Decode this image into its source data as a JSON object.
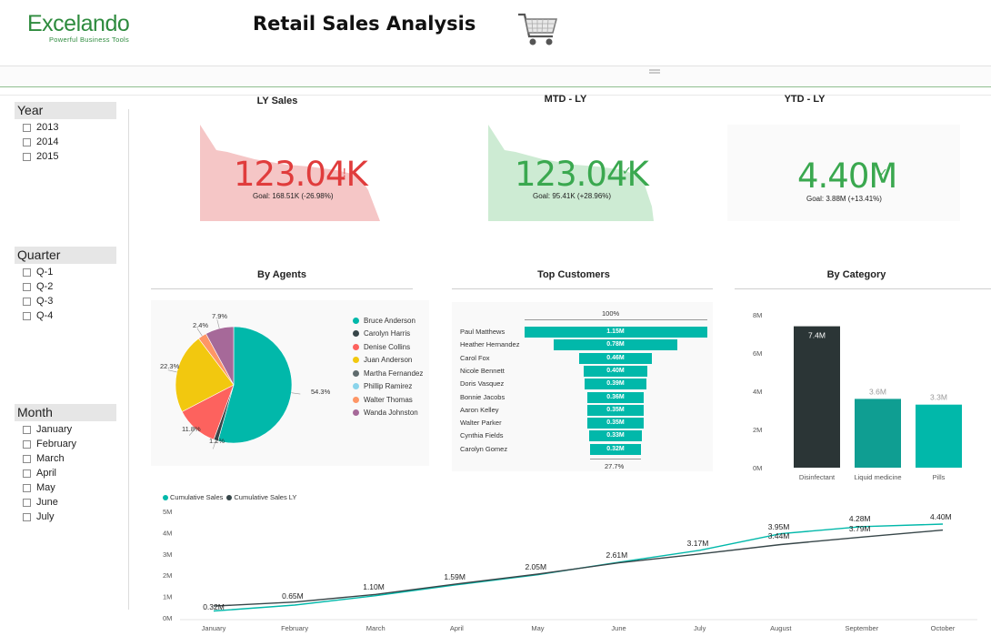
{
  "header": {
    "logo_text": "Excelando",
    "logo_tagline": "Powerful Business Tools",
    "title": "Retail Sales Analysis"
  },
  "slicers": {
    "year": {
      "title": "Year",
      "items": [
        "2013",
        "2014",
        "2015"
      ]
    },
    "quarter": {
      "title": "Quarter",
      "items": [
        "Q-1",
        "Q-2",
        "Q-3",
        "Q-4"
      ]
    },
    "month": {
      "title": "Month",
      "items": [
        "January",
        "February",
        "March",
        "April",
        "May",
        "June",
        "July"
      ]
    }
  },
  "kpis": [
    {
      "title": "LY Sales",
      "value": "123.04K",
      "goal": "Goal: 168.51K (-26.98%)",
      "status": "!",
      "color": "#e03c3c",
      "area_color": "#f5c6c6"
    },
    {
      "title": "MTD - LY",
      "value": "123.04K",
      "goal": "Goal: 95.41K (+28.96%)",
      "status": "✓",
      "color": "#3aa84f",
      "area_color": "#cdebd3"
    },
    {
      "title": "YTD - LY",
      "value": "4.40M",
      "goal": "Goal: 3.88M (+13.41%)",
      "status": "✓",
      "color": "#3aa84f",
      "area_color": "#ffffff"
    }
  ],
  "agents": {
    "title": "By Agents",
    "chart_data": {
      "type": "pie",
      "slices": [
        {
          "name": "Bruce Anderson",
          "value": 54.3,
          "color": "#01b8aa",
          "label": "54.3%"
        },
        {
          "name": "Carolyn Harris",
          "value": 1.2,
          "color": "#374649",
          "label": "1.2%"
        },
        {
          "name": "Denise Collins",
          "value": 11.8,
          "color": "#fd625e",
          "label": "11.8%"
        },
        {
          "name": "Juan Anderson",
          "value": 22.3,
          "color": "#f2c80f",
          "label": "22.3%"
        },
        {
          "name": "Martha Fernandez",
          "value": 0,
          "color": "#5f6b6d",
          "label": ""
        },
        {
          "name": "Phillip Ramirez",
          "value": 0,
          "color": "#8ad4eb",
          "label": ""
        },
        {
          "name": "Walter Thomas",
          "value": 2.4,
          "color": "#fe9666",
          "label": "2.4%"
        },
        {
          "name": "Wanda Johnston",
          "value": 7.9,
          "color": "#a66999",
          "label": "7.9%"
        }
      ]
    }
  },
  "customers": {
    "title": "Top Customers",
    "top_pct": "100%",
    "bottom_pct": "27.7%",
    "chart_data": {
      "type": "bar",
      "categories": [
        "Paul Matthews",
        "Heather Hernandez",
        "Carol Fox",
        "Nicole Bennett",
        "Doris Vasquez",
        "Bonnie Jacobs",
        "Aaron Kelley",
        "Walter Parker",
        "Cynthia Fields",
        "Carolyn Gomez"
      ],
      "values": [
        1.15,
        0.78,
        0.46,
        0.4,
        0.39,
        0.36,
        0.35,
        0.35,
        0.33,
        0.32
      ],
      "labels": [
        "1.15M",
        "0.78M",
        "0.46M",
        "0.40M",
        "0.39M",
        "0.36M",
        "0.35M",
        "0.35M",
        "0.33M",
        "0.32M"
      ]
    }
  },
  "category": {
    "title": "By Category",
    "chart_data": {
      "type": "bar",
      "categories": [
        "Disinfectant",
        "Liquid medicine",
        "Pills"
      ],
      "values": [
        7.4,
        3.6,
        3.3
      ],
      "labels": [
        "7.4M",
        "3.6M",
        "3.3M"
      ],
      "colors": [
        "#2b3536",
        "#0f9e92",
        "#01b8aa"
      ],
      "yticks": [
        "0M",
        "2M",
        "4M",
        "6M",
        "8M"
      ],
      "ylim": [
        0,
        8
      ]
    }
  },
  "cumulative": {
    "chart_data": {
      "type": "line",
      "x": [
        "January",
        "February",
        "March",
        "April",
        "May",
        "June",
        "July",
        "August",
        "September",
        "October"
      ],
      "series": [
        {
          "name": "Cumulative Sales",
          "color": "#01b8aa",
          "values": [
            0.32,
            0.6,
            1.04,
            1.55,
            2.02,
            2.61,
            3.17,
            3.95,
            4.28,
            4.4
          ]
        },
        {
          "name": "Cumulative Sales LY",
          "color": "#374649",
          "values": [
            0.55,
            0.74,
            1.1,
            1.59,
            2.05,
            2.58,
            3.0,
            3.44,
            3.79,
            4.12
          ]
        }
      ],
      "point_labels": [
        "0.32M",
        "0.65M",
        "1.10M",
        "1.59M",
        "2.05M",
        "2.61M",
        "3.17M",
        "3.95M",
        "4.28M",
        "4.40M"
      ],
      "extra_labels": [
        "3.44M",
        "3.79M"
      ],
      "yticks": [
        "0M",
        "1M",
        "2M",
        "3M",
        "4M",
        "5M"
      ],
      "ylim": [
        0,
        5
      ]
    }
  }
}
